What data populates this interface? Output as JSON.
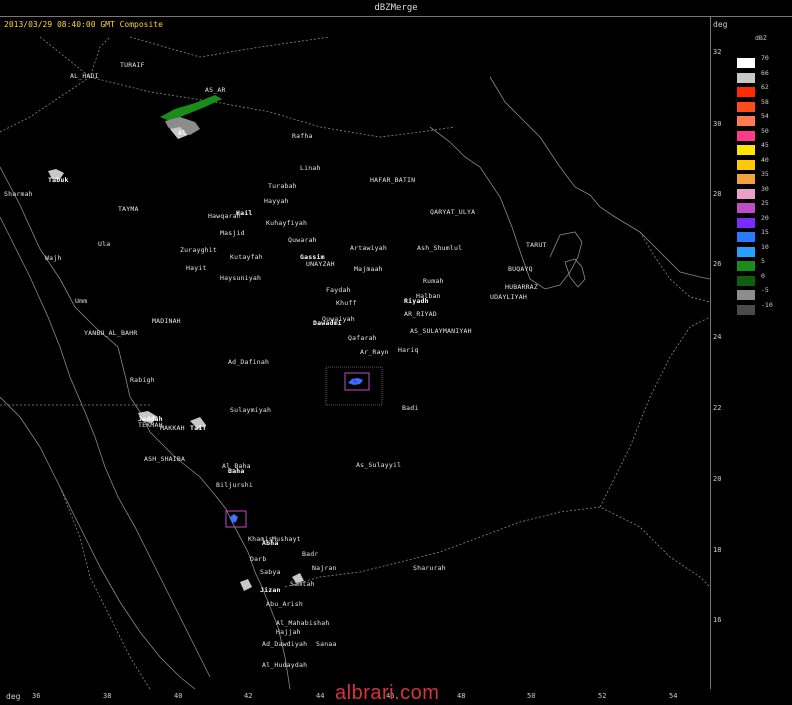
{
  "window": {
    "title": "dBZMerge"
  },
  "map": {
    "timestamp": "2013/03/29 08:40:00 GMT Composite",
    "unit_top": "deg",
    "unit_bottom": "deg",
    "lat_labels": [
      "32",
      "30",
      "28",
      "26",
      "24",
      "22",
      "20",
      "18",
      "16"
    ],
    "lon_labels": [
      "36",
      "38",
      "40",
      "42",
      "44",
      "46",
      "48",
      "50",
      "52",
      "54"
    ],
    "cities": [
      {
        "name": "AL_HADI",
        "bold": false
      },
      {
        "name": "TURAIF",
        "bold": false
      },
      {
        "name": "AS_AR",
        "bold": false
      },
      {
        "name": "Al",
        "bold": true
      },
      {
        "name": "Rafha",
        "bold": false
      },
      {
        "name": "Linah",
        "bold": false
      },
      {
        "name": "Turabah",
        "bold": false
      },
      {
        "name": "HAFAR_BATIN",
        "bold": false
      },
      {
        "name": "Tabuk",
        "bold": true
      },
      {
        "name": "Sharmah",
        "bold": false
      },
      {
        "name": "TAYMA",
        "bold": false
      },
      {
        "name": "Hayyah",
        "bold": false
      },
      {
        "name": "Hawqarah",
        "bold": false
      },
      {
        "name": "Hail",
        "bold": true
      },
      {
        "name": "Kuhayfiyah",
        "bold": false
      },
      {
        "name": "QARYAT_ULYA",
        "bold": false
      },
      {
        "name": "Masjid",
        "bold": false
      },
      {
        "name": "Quwarah",
        "bold": false
      },
      {
        "name": "Ula",
        "bold": false
      },
      {
        "name": "Zurayghit",
        "bold": false
      },
      {
        "name": "Artawiyah",
        "bold": false
      },
      {
        "name": "Ash_Shumlul",
        "bold": false
      },
      {
        "name": "TARUT",
        "bold": false
      },
      {
        "name": "Wajh",
        "bold": false
      },
      {
        "name": "Kutayfah",
        "bold": false
      },
      {
        "name": "Gassim",
        "bold": true
      },
      {
        "name": "UNAYZAH",
        "bold": false
      },
      {
        "name": "Hayit",
        "bold": false
      },
      {
        "name": "Majmaah",
        "bold": false
      },
      {
        "name": "BUQAYQ",
        "bold": false
      },
      {
        "name": "Haysuniyah",
        "bold": false
      },
      {
        "name": "Rumah",
        "bold": false
      },
      {
        "name": "HUBARRAZ",
        "bold": false
      },
      {
        "name": "Faydah",
        "bold": false
      },
      {
        "name": "Halban",
        "bold": false
      },
      {
        "name": "UDAYLIYAH",
        "bold": false
      },
      {
        "name": "Umm",
        "bold": false
      },
      {
        "name": "Khuff",
        "bold": false
      },
      {
        "name": "Riyadh",
        "bold": true
      },
      {
        "name": "AR_RIYAD",
        "bold": false
      },
      {
        "name": "MADINAH",
        "bold": false
      },
      {
        "name": "Quwaiyah",
        "bold": false
      },
      {
        "name": "Dawadmi",
        "bold": true
      },
      {
        "name": "YANBU_AL_BAHR",
        "bold": false
      },
      {
        "name": "AS_SULAYMANIYAH",
        "bold": false
      },
      {
        "name": "Qafarah",
        "bold": false
      },
      {
        "name": "Hariq",
        "bold": false
      },
      {
        "name": "Ar_Rayn",
        "bold": false
      },
      {
        "name": "Ad_Dafinah",
        "bold": false
      },
      {
        "name": "Rabigh",
        "bold": false
      },
      {
        "name": "Sulaymiyah",
        "bold": false
      },
      {
        "name": "Badi",
        "bold": false
      },
      {
        "name": "Jeddah",
        "bold": true
      },
      {
        "name": "TEKMAH",
        "bold": false
      },
      {
        "name": "MAKKAH",
        "bold": false
      },
      {
        "name": "Taif",
        "bold": true
      },
      {
        "name": "ASH_SHAIBA",
        "bold": false
      },
      {
        "name": "As_Sulayyil",
        "bold": false
      },
      {
        "name": "Al_Baha",
        "bold": false
      },
      {
        "name": "Baha",
        "bold": true
      },
      {
        "name": "Biljurshi",
        "bold": false
      },
      {
        "name": "Khamis",
        "bold": false
      },
      {
        "name": "Mushayt",
        "bold": false
      },
      {
        "name": "Abha",
        "bold": true
      },
      {
        "name": "Badr",
        "bold": false
      },
      {
        "name": "Darb",
        "bold": false
      },
      {
        "name": "Najran",
        "bold": false
      },
      {
        "name": "Sharurah",
        "bold": false
      },
      {
        "name": "Sabya",
        "bold": false
      },
      {
        "name": "Jizan",
        "bold": true
      },
      {
        "name": "Abu_Arish",
        "bold": false
      },
      {
        "name": "Samtah",
        "bold": false
      },
      {
        "name": "Al_Mahabishah",
        "bold": false
      },
      {
        "name": "Hajjah",
        "bold": false
      },
      {
        "name": "Ad_Dawdiyah",
        "bold": false
      },
      {
        "name": "Sanaa",
        "bold": false
      },
      {
        "name": "Al_Hudaydah",
        "bold": false
      }
    ]
  },
  "legend": {
    "unit": "dBZ",
    "levels": [
      {
        "value": "70",
        "color": "#ffffff"
      },
      {
        "value": "66",
        "color": "#c8c8c8"
      },
      {
        "value": "62",
        "color": "#ff2a00"
      },
      {
        "value": "58",
        "color": "#ff4a1c"
      },
      {
        "value": "54",
        "color": "#ff7a50"
      },
      {
        "value": "50",
        "color": "#ff3a8a"
      },
      {
        "value": "45",
        "color": "#ffe400"
      },
      {
        "value": "40",
        "color": "#ffc800"
      },
      {
        "value": "35",
        "color": "#f2a23c"
      },
      {
        "value": "30",
        "color": "#e8a0c8"
      },
      {
        "value": "25",
        "color": "#c04cc8"
      },
      {
        "value": "20",
        "color": "#7a2cff"
      },
      {
        "value": "15",
        "color": "#2a7aff"
      },
      {
        "value": "10",
        "color": "#28a0ff"
      },
      {
        "value": "5",
        "color": "#1a8c1a"
      },
      {
        "value": "0",
        "color": "#0e5e0e"
      },
      {
        "value": "-5",
        "color": "#8c8c8c"
      },
      {
        "value": "-10",
        "color": "#4a4a4a"
      }
    ]
  },
  "watermark": "albrari.com"
}
